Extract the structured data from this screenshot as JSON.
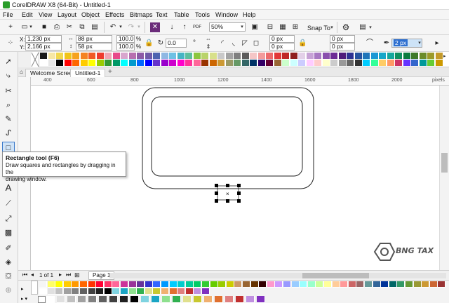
{
  "app": {
    "title": "CorelDRAW X8 (64-Bit) - Untitled-1"
  },
  "menu": [
    "File",
    "Edit",
    "View",
    "Layout",
    "Object",
    "Effects",
    "Bitmaps",
    "Text",
    "Table",
    "Tools",
    "Window",
    "Help"
  ],
  "standard_toolbar": {
    "zoom": "50%",
    "snap": "Snap To"
  },
  "property_bar": {
    "x": "1,230 px",
    "y": "2,166 px",
    "w": "88 px",
    "h": "58 px",
    "scale_x": "100.0",
    "scale_y": "100.0",
    "percent": "%",
    "angle": "0.0",
    "corner1": "0 px",
    "corner2": "0 px",
    "corner3": "0 px",
    "corner4": "0 px",
    "outline": "2 px"
  },
  "tabs": {
    "welcome": "Welcome Screen",
    "doc": "Untitled-1",
    "add": "+"
  },
  "ruler": {
    "marks": [
      "400",
      "600",
      "800",
      "1000",
      "1200",
      "1400",
      "1600",
      "1800",
      "2000"
    ],
    "unit": "pixels"
  },
  "tooltip": {
    "title": "Rectangle tool (F6)",
    "line1": "Draw squares and rectangles by dragging in the",
    "line2": "drawing window."
  },
  "pagebar": {
    "counter": "1 of 1",
    "page": "Page 1"
  },
  "watermark": "BNG TAX",
  "colors": {
    "palette_top_row1": [
      "#1a1a1a",
      "#f7e7a4",
      "#f1d74d",
      "#f0c419",
      "#f6a21d",
      "#f58220",
      "#f15a24",
      "#ee3a2c",
      "#f0a6b4",
      "#e84a8a",
      "#d8a6cd",
      "#b76fb0",
      "#8c5aa6",
      "#6f5aa8",
      "#4d63b0",
      "#8fb8e3",
      "#6ec1e4",
      "#45b4c4",
      "#5cbf9e",
      "#8cc63f",
      "#b9d36a",
      "#d8e08a",
      "#c9c9c9",
      "#a3a3a3",
      "#7f7f7f",
      "#5b5b5b",
      "#f5c6c6",
      "#f39a9a",
      "#ed6a6a",
      "#e23838",
      "#c02727",
      "#8f1e1e",
      "#e3d0e8",
      "#c7a2d6",
      "#a878c3",
      "#8a4fae",
      "#6d2c95",
      "#4f1b7a",
      "#2e3192",
      "#26529f",
      "#1f75b9",
      "#1b98d4",
      "#17a7c9",
      "#15a79d",
      "#0f8f5f",
      "#0b7b3e",
      "#3e7a2a",
      "#6a8c2a",
      "#9c9a2a",
      "#c49a2a"
    ],
    "palette_top_row2": [
      "#ffffff",
      "#e6e6e6",
      "#000000",
      "#ff0000",
      "#ff6600",
      "#ffcc00",
      "#ffff00",
      "#99cc00",
      "#339933",
      "#009966",
      "#00ffff",
      "#0099cc",
      "#0066ff",
      "#0000ff",
      "#6633cc",
      "#9900cc",
      "#cc00cc",
      "#ff00cc",
      "#ff3399",
      "#ff6699",
      "#993300",
      "#cc6600",
      "#cc9933",
      "#999966",
      "#669966",
      "#336666",
      "#003366",
      "#330066",
      "#660033",
      "#996633",
      "#ccffcc",
      "#ccffff",
      "#ccccff",
      "#ffccff",
      "#ffcccc",
      "#ffffcc",
      "#cccccc",
      "#999999",
      "#666666",
      "#333333",
      "#00ccff",
      "#33ff99",
      "#ffcc66",
      "#ff9966",
      "#cc3366",
      "#6633ff",
      "#3366cc",
      "#009999",
      "#66cc33",
      "#cc9900"
    ],
    "doc_row1": [
      "#f5f5f5",
      "#ffff66",
      "#ffff00",
      "#ffcc00",
      "#ff9900",
      "#ff6600",
      "#ff3300",
      "#ff0033",
      "#ff3366",
      "#ff6699",
      "#cc3399",
      "#993399",
      "#663399",
      "#3333cc",
      "#3366ff",
      "#0099ff",
      "#00ccff",
      "#00cccc",
      "#00cc99",
      "#00cc66",
      "#33cc33",
      "#66cc00",
      "#99cc00",
      "#cccc00",
      "#cc9966",
      "#996633",
      "#663300",
      "#330000",
      "#ff99cc",
      "#cc99ff",
      "#9999ff",
      "#99ccff",
      "#99ffff",
      "#99ffcc",
      "#ccff99",
      "#ffff99",
      "#ffcc99",
      "#ff9999",
      "#cc6666",
      "#996666",
      "#669999",
      "#336699",
      "#003399",
      "#006666",
      "#339966",
      "#669933",
      "#999933",
      "#cc9933",
      "#cc6633",
      "#993333"
    ],
    "doc_row2": [
      "#ffffff",
      "#e0e0e0",
      "#c0c0c0",
      "#a0a0a0",
      "#808080",
      "#606060",
      "#404040",
      "#202020",
      "#000000",
      "#7fd3e0",
      "#1aa5c4",
      "#8ee08e",
      "#30b050",
      "#e0e08e",
      "#c8c830",
      "#f0b070",
      "#e07030",
      "#e08080",
      "#c03030",
      "#c090e0",
      "#8030c0"
    ]
  }
}
